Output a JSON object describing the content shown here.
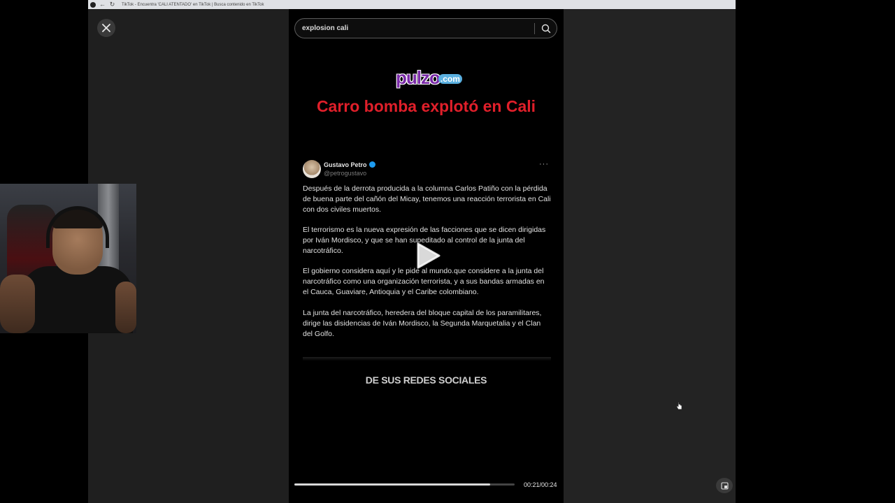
{
  "browser": {
    "tab_title": "TikTok - Encuentra 'CALI ATENTADO' en TikTok | Busca contenido en TikTok"
  },
  "search": {
    "query": "explosion cali"
  },
  "video": {
    "logo_main": "pulzo",
    "logo_suffix": ".com",
    "headline": "Carro bomba explotó en Cali",
    "tweet": {
      "name": "Gustavo Petro",
      "handle": "@petrogustavo",
      "more": "···",
      "paragraphs": [
        "Después de la derrota producida a la columna Carlos Patiño con la pérdida de buena parte del cañón del Micay, tenemos una reacción terrorista en Cali con dos civiles muertos.",
        "El terrorismo es la nueva expresión de las facciones que se dicen dirigidas por Iván Mordisco, y que se han supeditado al control de la junta del narcotráfico.",
        "El gobierno  considera aquí y le pide al mundo.que considere a la junta del narcotráfico como una organización terrorista, y a sus bandas armadas en el Cauca, Guaviare, Antioquia y el Caribe colombiano.",
        "La junta del narcotráfico, heredera del bloque capital de los paramilitares,\n dirige las disidencias de Iván Mordisco, la Segunda Marquetalia y el Clan del Golfo."
      ]
    },
    "caption": "DE SUS REDES SOCIALES",
    "progress_fraction": 0.89,
    "time": "00:21/00:24"
  },
  "icons": {
    "close": "close-icon",
    "search": "search-icon",
    "play": "play-icon",
    "mini_player": "mini-player-icon",
    "cursor": "hand-cursor-icon"
  },
  "colors": {
    "headline": "#e01f2a",
    "logo": "#7a2aa8",
    "verified": "#1d9bf0"
  }
}
